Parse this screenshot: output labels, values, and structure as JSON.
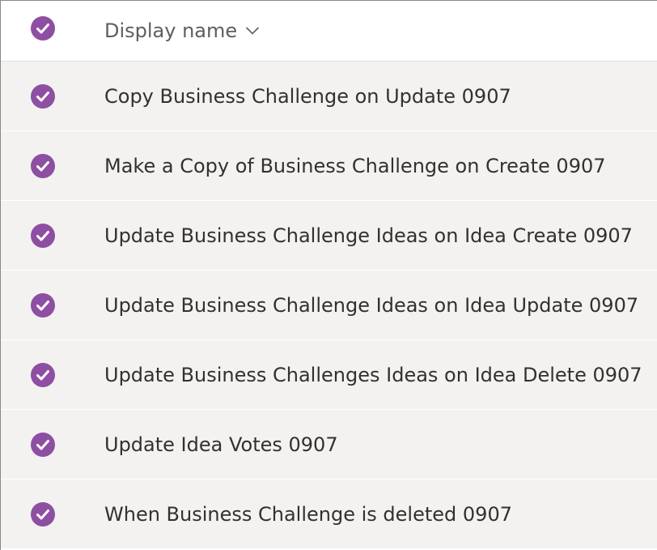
{
  "colors": {
    "accent": "#8e4fa3",
    "row_background": "#f3f2f1",
    "header_text": "#605e5c",
    "row_text": "#323130"
  },
  "header": {
    "column_label": "Display name",
    "sort_icon": "chevron-down-icon",
    "select_all_icon": "checkmark-circle-icon"
  },
  "rows": [
    {
      "label": "Copy Business Challenge on Update 0907",
      "selected": true
    },
    {
      "label": "Make a Copy of Business Challenge on Create 0907",
      "selected": true
    },
    {
      "label": "Update Business Challenge Ideas on Idea Create 0907",
      "selected": true
    },
    {
      "label": "Update Business Challenge Ideas on Idea Update 0907",
      "selected": true
    },
    {
      "label": "Update Business Challenges Ideas on Idea Delete 0907",
      "selected": true
    },
    {
      "label": "Update Idea Votes 0907",
      "selected": true
    },
    {
      "label": "When Business Challenge is deleted 0907",
      "selected": true
    }
  ]
}
